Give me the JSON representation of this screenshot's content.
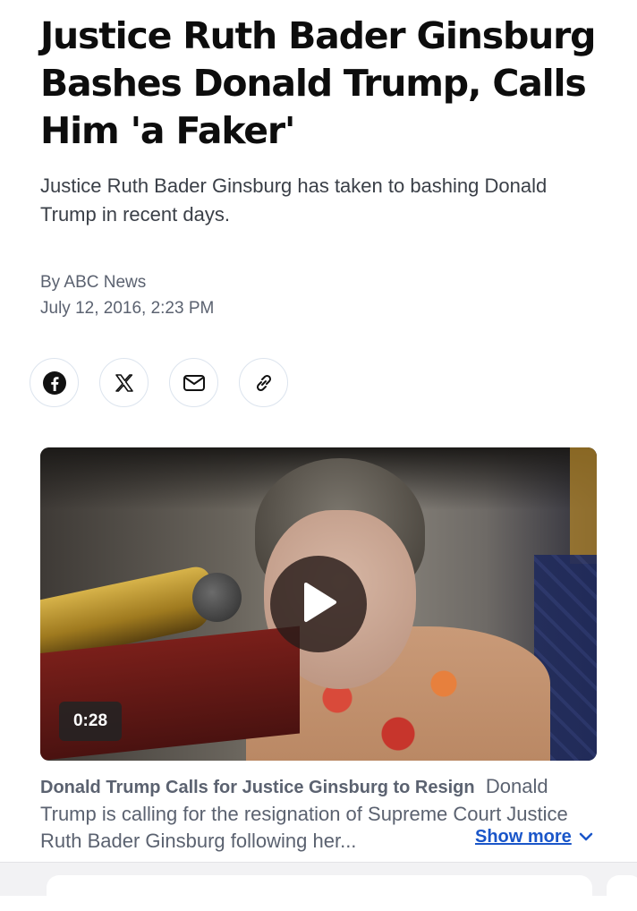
{
  "article": {
    "headline": "Justice Ruth Bader Ginsburg Bashes Donald Trump, Calls Him 'a Faker'",
    "dek": "Justice Ruth Bader Ginsburg has taken to bashing Donald Trump in recent days.",
    "byline": "By ABC News",
    "timestamp": "July 12, 2016, 2:23 PM"
  },
  "share": {
    "items": [
      {
        "icon": "facebook-icon"
      },
      {
        "icon": "x-icon"
      },
      {
        "icon": "mail-icon"
      },
      {
        "icon": "link-icon"
      }
    ]
  },
  "video": {
    "duration": "0:28",
    "icon": "play-icon"
  },
  "caption": {
    "title": "Donald Trump Calls for Justice Ginsburg to Resign",
    "text": "Donald Trump is calling for the resignation of Supreme Court Justice Ruth Bader Ginsburg following her...",
    "show_more": "Show more",
    "show_more_icon": "chevron-down-icon"
  },
  "colors": {
    "link": "#1a56c9",
    "meta_text": "#5b6270",
    "headline": "#0d0d0d"
  }
}
